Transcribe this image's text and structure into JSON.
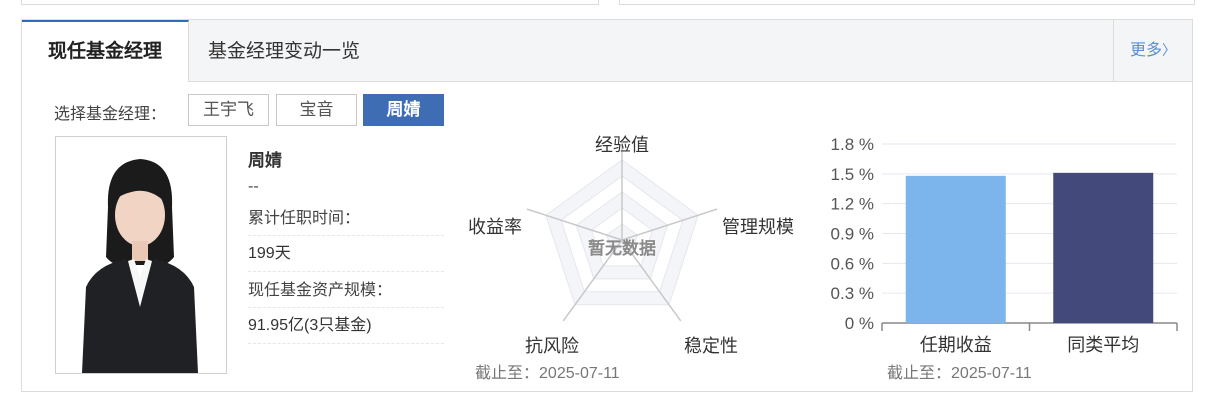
{
  "tabs": {
    "active": "现任基金经理",
    "second": "基金经理变动一览",
    "more": "更多"
  },
  "selector": {
    "label": "选择基金经理：",
    "managers": [
      "王宇飞",
      "宝音",
      "周婧"
    ],
    "selected": "周婧"
  },
  "manager": {
    "name": "周婧",
    "subtitle": "--",
    "tenure_label": "累计任职时间：",
    "tenure_value": "199天",
    "aum_label": "现任基金资产规模：",
    "aum_value": "91.95亿(3只基金)"
  },
  "radar": {
    "axes": [
      "经验值",
      "管理规模",
      "稳定性",
      "抗风险",
      "收益率"
    ],
    "empty_text": "暂无数据",
    "cutoff_label": "截止至：",
    "cutoff_date": "2025-07-11"
  },
  "chart_data": {
    "type": "bar",
    "categories": [
      "任期收益",
      "同类平均"
    ],
    "values": [
      1.48,
      1.51
    ],
    "ylim": [
      0,
      1.8
    ],
    "yticks": [
      "0 %",
      "0.3 %",
      "0.6 %",
      "0.9 %",
      "1.2 %",
      "1.5 %",
      "1.8 %"
    ],
    "colors": [
      "#7cb5ec",
      "#434a7b"
    ],
    "grid": true,
    "cutoff_label": "截止至：",
    "cutoff_date": "2025-07-11"
  },
  "colors": {
    "accent": "#3f6db3",
    "link": "#5a8fd0"
  }
}
